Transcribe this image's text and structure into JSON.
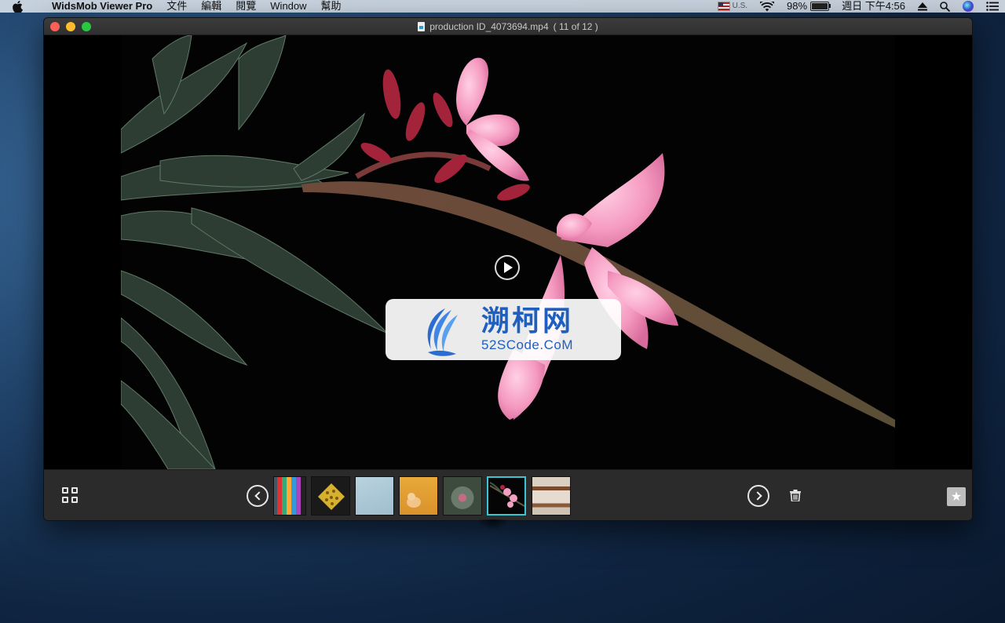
{
  "menubar": {
    "app_name": "WidsMob Viewer Pro",
    "menus": [
      "文件",
      "編輯",
      "閱覽",
      "Window",
      "幫助"
    ],
    "input_source": "U.S.",
    "battery_percent": "98%",
    "battery_level": 0.98,
    "clock": "週日 下午4:56"
  },
  "window": {
    "title": "production ID_4073694.mp4",
    "counter": "( 11 of 12 )"
  },
  "media": {
    "kind": "video",
    "subject": "pink-flower-branch"
  },
  "watermark": {
    "chinese": "溯柯网",
    "url": "52SCode.CoM"
  },
  "filmstrip": {
    "selected_index": 5,
    "thumbnails": [
      "colorful-shelves",
      "yellow-pattern",
      "pale-blue-sky",
      "orange-cat",
      "pink-flower-pattern",
      "pink-flower-dark",
      "wooden-windows"
    ]
  },
  "colors": {
    "accent": "#37c6d2",
    "watermark_blue": "#1f5fbf"
  }
}
